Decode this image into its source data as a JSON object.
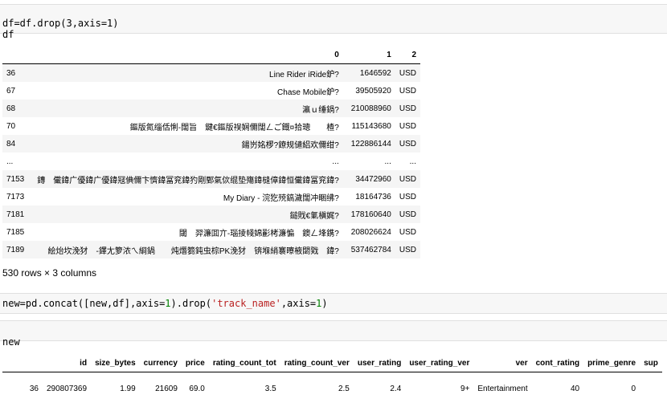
{
  "cell1": {
    "line1": "df=df.drop(3,axis=1)",
    "line2": "df"
  },
  "table1": {
    "columns": [
      "",
      "0",
      "1",
      "2"
    ],
    "rows": [
      {
        "idx": "36",
        "c0": "Line Rider iRide鈩?",
        "c1": "1646592",
        "c2": "USD"
      },
      {
        "idx": "67",
        "c0": "Chase Mobile鈩?",
        "c1": "39505920",
        "c2": "USD"
      },
      {
        "idx": "68",
        "c0": "瀛ｕ缍鍋?",
        "c1": "210088960",
        "c2": "USD"
      },
      {
        "idx": "70",
        "c0": "鏂版氮缁佸悧-闊旨　鍵€鏂版祦娴儞闊ㄥご鐡¤拾璁　　楂?",
        "c1": "115143680",
        "c2": "USD"
      },
      {
        "idx": "84",
        "c0": "鍚岃姳椤?鐐规儙絽欢儞绀?",
        "c1": "122886144",
        "c2": "USD"
      },
      {
        "idx": "...",
        "c0": "...",
        "c1": "...",
        "c2": "..."
      },
      {
        "idx": "7153",
        "c0": "鏄　儎鍏广優鍏广優鍏冦倎儞卞懠鍏冨兖鍏犳剛鄄氣佽绲垫殤鍏槰傽鍏恒儎鍏冨兖鍏?",
        "c1": "34472960",
        "c2": "USD"
      },
      {
        "idx": "7173",
        "c0": "My Diary - 浣犵殑鎬濊闊冲睏绋?",
        "c1": "18164736",
        "c2": "USD"
      },
      {
        "idx": "7181",
        "c0": "鎚戝€氭槇娓?",
        "c1": "178160640",
        "c2": "USD"
      },
      {
        "idx": "7185",
        "c0": "閾　羿濂囬亣-瑙掕帴婂彲栲濂惼　鐭ㄥ埄鎸?",
        "c1": "208026624",
        "c2": "USD"
      },
      {
        "idx": "7189",
        "c0": "絵炲坎浼犲　-鐸尢箩浓ㄟ綗鍋　　炖熸篘鈍虫棕PK浼犲　锛堢綃褰曢棭閟戣　鍏?",
        "c1": "537462784",
        "c2": "USD"
      }
    ]
  },
  "row_count": "530 rows × 3 columns",
  "cell2": {
    "pre": "new=pd.concat([new,df],axis=",
    "one1": "1",
    "mid": ").drop(",
    "str": "'track_name'",
    "mid2": ",axis=",
    "one2": "1",
    "post": ")"
  },
  "cell3": {
    "line1": "new"
  },
  "table2": {
    "columns": [
      "",
      "id",
      "size_bytes",
      "currency",
      "price",
      "rating_count_tot",
      "rating_count_ver",
      "user_rating",
      "user_rating_ver",
      "ver",
      "cont_rating",
      "prime_genre",
      "sup"
    ],
    "row": [
      "36",
      "290807369",
      "1.99",
      "21609",
      "69.0",
      "3.5",
      "2.5",
      "2.4",
      "9+",
      "Entertainment",
      "40",
      "0",
      ""
    ]
  }
}
